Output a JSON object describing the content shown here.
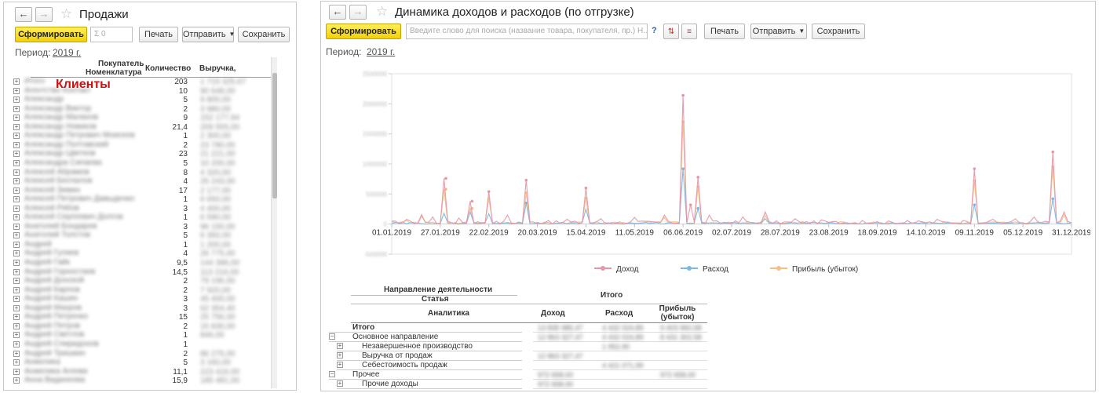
{
  "sales": {
    "title": "Продажи",
    "generate_label": "Сформировать",
    "sigma_placeholder": "Σ 0",
    "print_label": "Печать",
    "send_label": "Отправить",
    "save_label": "Сохранить",
    "period_label": "Период:",
    "period_value": "2019 г.",
    "columns": {
      "buyer": "Покупатель",
      "nomenclature": "Номенклатура",
      "quantity": "Количество",
      "revenue": "Выручка,"
    },
    "overlay_label": "Клиенты",
    "overlay_color": "#cc1111",
    "rows": [
      {
        "name": "Итого",
        "qty": "203",
        "rev": "1 715 325,67"
      },
      {
        "name": "Агентство Контакт",
        "qty": "10",
        "rev": "90 648,00"
      },
      {
        "name": "Александр",
        "qty": "5",
        "rev": "9 800,00"
      },
      {
        "name": "Александр Виктор",
        "qty": "2",
        "rev": "3 980,00"
      },
      {
        "name": "Александр Малахов",
        "qty": "9",
        "rev": "152 177,94"
      },
      {
        "name": "Александр Новиков",
        "qty": "21,4",
        "rev": "209 555,00"
      },
      {
        "name": "Александр Петрович Моисеев",
        "qty": "1",
        "rev": "2 300,00"
      },
      {
        "name": "Александр Полтавский",
        "qty": "2",
        "rev": "23 780,00"
      },
      {
        "name": "Александр Цветков",
        "qty": "23",
        "rev": "21 221,00"
      },
      {
        "name": "Александра Сипаева",
        "qty": "5",
        "rev": "10 200,00"
      },
      {
        "name": "Алексей Абрамов",
        "qty": "8",
        "rev": "4 320,00"
      },
      {
        "name": "Алексей Беспалов",
        "qty": "4",
        "rev": "26 243,00"
      },
      {
        "name": "Алексей Зимин",
        "qty": "17",
        "rev": "2 177,00"
      },
      {
        "name": "Алексей Петрович Давыденко",
        "qty": "1",
        "rev": "6 650,00"
      },
      {
        "name": "Алексей Рябов",
        "qty": "3",
        "rev": "4 400,00"
      },
      {
        "name": "Алексей Сергеевич Долгов",
        "qty": "1",
        "rev": "6 590,00"
      },
      {
        "name": "Анатолий Бондарев",
        "qty": "3",
        "rev": "96 150,00"
      },
      {
        "name": "Анатолий Толстов",
        "qty": "5",
        "rev": "6 350,00"
      },
      {
        "name": "Андрей",
        "qty": "1",
        "rev": "1 200,00"
      },
      {
        "name": "Андрей Гуляев",
        "qty": "4",
        "rev": "26 775,00"
      },
      {
        "name": "Андрей Гайк",
        "qty": "9,5",
        "rev": "144 396,00"
      },
      {
        "name": "Андрей Горностаев",
        "qty": "14,5",
        "rev": "113 216,00"
      },
      {
        "name": "Андрей Донской",
        "qty": "2",
        "rev": "79 196,00"
      },
      {
        "name": "Андрей Карпов",
        "qty": "2",
        "rev": "7 920,00"
      },
      {
        "name": "Андрей Кашин",
        "qty": "3",
        "rev": "45 400,00"
      },
      {
        "name": "Андрей Махров",
        "qty": "3",
        "rev": "62 354,40"
      },
      {
        "name": "Андрей Петренко",
        "qty": "15",
        "rev": "25 756,00"
      },
      {
        "name": "Андрей Петров",
        "qty": "2",
        "rev": "15 830,00"
      },
      {
        "name": "Андрей Светлов",
        "qty": "1",
        "rev": "846,00"
      },
      {
        "name": "Андрей Спиридонов",
        "qty": "1",
        "rev": ""
      },
      {
        "name": "Андрей Тришкин",
        "qty": "2",
        "rev": "86 275,00"
      },
      {
        "name": "Анжелика",
        "qty": "5",
        "rev": "3 160,00"
      },
      {
        "name": "Анжелика Агеева",
        "qty": "11,1",
        "rev": "223 416,00"
      },
      {
        "name": "Анна Видинеева",
        "qty": "15,9",
        "rev": "185 481,00"
      }
    ]
  },
  "dynamics": {
    "title": "Динамика доходов и расходов (по отгрузке)",
    "generate_label": "Сформировать",
    "search_placeholder": "Введите слово для поиска (название товара, покупателя, пр.) Н...",
    "help_label": "?",
    "print_label": "Печать",
    "send_label": "Отправить",
    "save_label": "Сохранить",
    "period_label": "Период:",
    "period_value": "2019 г.",
    "legend": [
      {
        "name": "Доход",
        "color": "#e597a8"
      },
      {
        "name": "Расход",
        "color": "#7fb7e3"
      },
      {
        "name": "Прибыль (убыток)",
        "color": "#f6be85"
      }
    ],
    "table": {
      "dimension_header": "Направление деятельности",
      "article_header": "Статья",
      "analytics_header": "Аналитика",
      "total_header": "Итого",
      "income_header": "Доход",
      "expense_header": "Расход",
      "profit_header": "Прибыль (убыток)",
      "rows": [
        {
          "label": "Итого",
          "bold": true,
          "level": 0,
          "income": "13 835 985,47",
          "expense": "4 432 024,89",
          "profit": "9 403 960,58"
        },
        {
          "label": "Основное направление",
          "level": 0,
          "income": "12 863 327,47",
          "expense": "4 432 024,89",
          "profit": "8 431 302,58"
        },
        {
          "label": "Незавершенное производство",
          "level": 1,
          "income": "",
          "expense": "1 952,90",
          "profit": ""
        },
        {
          "label": "Выручка от продаж",
          "level": 1,
          "income": "12 863 327,47",
          "expense": "",
          "profit": ""
        },
        {
          "label": "Себестоимость продаж",
          "level": 1,
          "income": "",
          "expense": "4 421 071,99",
          "profit": ""
        },
        {
          "label": "Прочее",
          "level": 0,
          "income": "972 658,00",
          "expense": "",
          "profit": "972 658,00"
        },
        {
          "label": "Прочие доходы",
          "level": 1,
          "income": "972 658,00",
          "expense": "",
          "profit": ""
        }
      ]
    }
  },
  "chart_data": {
    "type": "line",
    "title": "",
    "x_ticks": [
      "01.01.2019",
      "27.01.2019",
      "22.02.2019",
      "20.03.2019",
      "15.04.2019",
      "11.05.2019",
      "06.06.2019",
      "02.07.2019",
      "28.07.2019",
      "23.08.2019",
      "18.09.2019",
      "14.10.2019",
      "09.11.2019",
      "05.12.2019",
      "31.12.2019"
    ],
    "y_ticks": [
      "2500000",
      "2000000",
      "1500000",
      "1000000",
      "500000",
      "0",
      "-500000"
    ],
    "ylim": [
      -500000,
      2500000
    ],
    "xlim": [
      "2019-01-01",
      "2019-12-31"
    ],
    "series": [
      {
        "name": "Доход",
        "color": "#e597a8",
        "points": [
          [
            "2019-01-10",
            80000
          ],
          [
            "2019-01-18",
            160000
          ],
          [
            "2019-01-24",
            120000
          ],
          [
            "2019-01-30",
            760000
          ],
          [
            "2019-02-06",
            100000
          ],
          [
            "2019-02-13",
            380000
          ],
          [
            "2019-02-22",
            540000
          ],
          [
            "2019-03-04",
            150000
          ],
          [
            "2019-03-14",
            730000
          ],
          [
            "2019-03-26",
            60000
          ],
          [
            "2019-04-06",
            80000
          ],
          [
            "2019-04-15",
            600000
          ],
          [
            "2019-04-24",
            90000
          ],
          [
            "2019-05-11",
            110000
          ],
          [
            "2019-05-28",
            150000
          ],
          [
            "2019-06-06",
            2140000
          ],
          [
            "2019-06-10",
            320000
          ],
          [
            "2019-06-14",
            780000
          ],
          [
            "2019-06-20",
            150000
          ],
          [
            "2019-07-08",
            120000
          ],
          [
            "2019-07-20",
            200000
          ],
          [
            "2019-08-05",
            90000
          ],
          [
            "2019-08-20",
            70000
          ],
          [
            "2019-09-10",
            60000
          ],
          [
            "2019-10-05",
            60000
          ],
          [
            "2019-10-20",
            80000
          ],
          [
            "2019-11-03",
            60000
          ],
          [
            "2019-11-09",
            920000
          ],
          [
            "2019-11-20",
            80000
          ],
          [
            "2019-12-01",
            90000
          ],
          [
            "2019-12-11",
            120000
          ],
          [
            "2019-12-21",
            1200000
          ],
          [
            "2019-12-27",
            200000
          ]
        ]
      },
      {
        "name": "Расход",
        "color": "#7fb7e3",
        "points": [
          [
            "2019-01-30",
            180000
          ],
          [
            "2019-02-13",
            200000
          ],
          [
            "2019-02-22",
            170000
          ],
          [
            "2019-03-14",
            350000
          ],
          [
            "2019-04-15",
            250000
          ],
          [
            "2019-06-06",
            920000
          ],
          [
            "2019-06-14",
            260000
          ],
          [
            "2019-07-20",
            90000
          ],
          [
            "2019-11-09",
            320000
          ],
          [
            "2019-12-21",
            420000
          ]
        ]
      },
      {
        "name": "Прибыль (убыток)",
        "color": "#f6be85",
        "points": [
          [
            "2019-01-10",
            60000
          ],
          [
            "2019-01-18",
            130000
          ],
          [
            "2019-01-30",
            580000
          ],
          [
            "2019-02-13",
            260000
          ],
          [
            "2019-02-22",
            420000
          ],
          [
            "2019-03-14",
            520000
          ],
          [
            "2019-04-15",
            430000
          ],
          [
            "2019-05-28",
            110000
          ],
          [
            "2019-06-06",
            1700000
          ],
          [
            "2019-06-14",
            620000
          ],
          [
            "2019-07-20",
            140000
          ],
          [
            "2019-11-09",
            720000
          ],
          [
            "2019-12-21",
            950000
          ],
          [
            "2019-12-27",
            150000
          ]
        ]
      }
    ]
  }
}
